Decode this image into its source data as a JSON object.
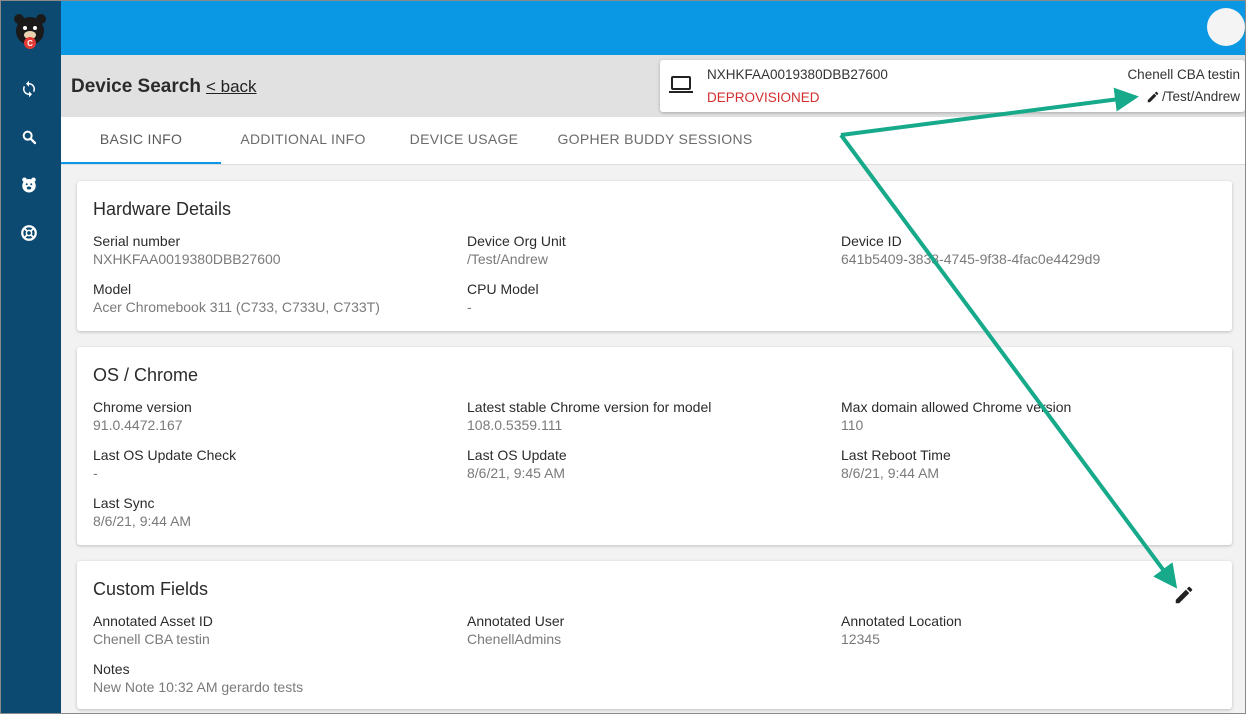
{
  "header": {
    "page_title": "Device Search",
    "back_label": "< back"
  },
  "device_card": {
    "serial": "NXHKFAA0019380DBB27600",
    "status": "DEPROVISIONED",
    "user": "Chenell CBA testin",
    "org_unit": "/Test/Andrew"
  },
  "tabs": [
    {
      "label": "BASIC INFO"
    },
    {
      "label": "ADDITIONAL INFO"
    },
    {
      "label": "DEVICE USAGE"
    },
    {
      "label": "GOPHER BUDDY SESSIONS"
    }
  ],
  "hardware": {
    "title": "Hardware Details",
    "fields": [
      {
        "label": "Serial number",
        "value": "NXHKFAA0019380DBB27600"
      },
      {
        "label": "Device Org Unit",
        "value": "/Test/Andrew"
      },
      {
        "label": "Device ID",
        "value": "641b5409-3838-4745-9f38-4fac0e4429d9"
      },
      {
        "label": "Model",
        "value": "Acer Chromebook 311 (C733, C733U, C733T)"
      },
      {
        "label": "CPU Model",
        "value": "-"
      }
    ]
  },
  "os": {
    "title": "OS / Chrome",
    "fields": [
      {
        "label": "Chrome version",
        "value": "91.0.4472.167"
      },
      {
        "label": "Latest stable Chrome version for model",
        "value": "108.0.5359.111"
      },
      {
        "label": "Max domain allowed Chrome version",
        "value": "110"
      },
      {
        "label": "Last OS Update Check",
        "value": "-"
      },
      {
        "label": "Last OS Update",
        "value": "8/6/21, 9:45 AM"
      },
      {
        "label": "Last Reboot Time",
        "value": "8/6/21, 9:44 AM"
      },
      {
        "label": "Last Sync",
        "value": "8/6/21, 9:44 AM"
      }
    ]
  },
  "custom": {
    "title": "Custom Fields",
    "fields": [
      {
        "label": "Annotated Asset ID",
        "value": "Chenell CBA testin"
      },
      {
        "label": "Annotated User",
        "value": "ChenellAdmins"
      },
      {
        "label": "Annotated Location",
        "value": "12345"
      },
      {
        "label": "Notes",
        "value": "New Note 10:32 AM gerardo tests"
      }
    ]
  },
  "colors": {
    "sidebar": "#0c4a72",
    "topbar": "#0a97e3",
    "status_red": "#d32f2f",
    "annotation_arrow": "#16a98a"
  },
  "icons": [
    "logo-icon",
    "sync-icon",
    "search-icon",
    "bear-icon",
    "support-icon",
    "laptop-icon",
    "pencil-icon"
  ]
}
